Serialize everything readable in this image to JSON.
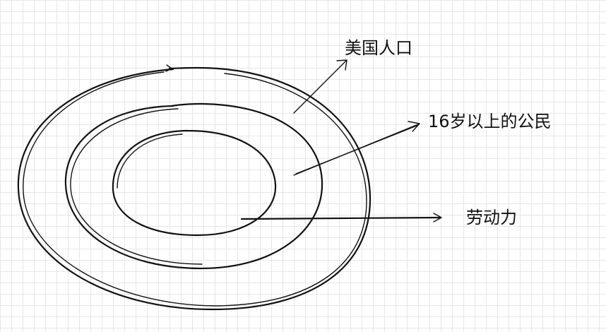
{
  "diagram": {
    "rings": [
      {
        "label": "美国人口"
      },
      {
        "label": "16岁以上的公民"
      },
      {
        "label": "劳动力"
      }
    ],
    "colors": {
      "stroke": "#111111",
      "grid": "#e6e6e6",
      "background": "#ffffff"
    }
  }
}
